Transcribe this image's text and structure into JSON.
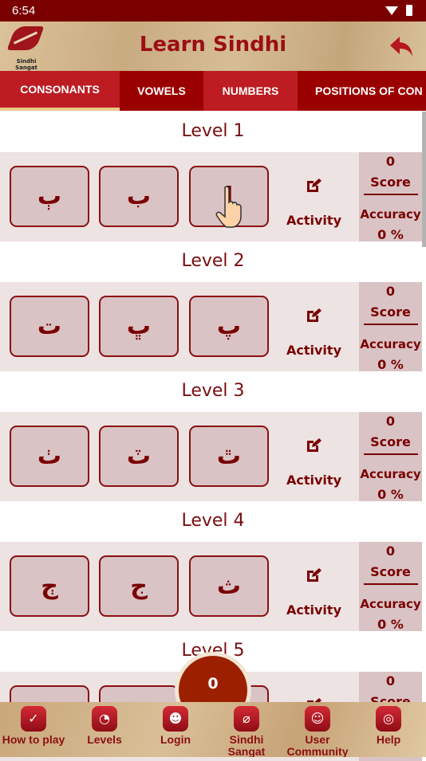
{
  "status_bar": {
    "time": "6:54"
  },
  "header": {
    "logo_text": "Sindhi Sangat",
    "title": "Learn Sindhi"
  },
  "tabs": [
    {
      "label": "CONSONANTS",
      "selected": true
    },
    {
      "label": "VOWELS"
    },
    {
      "label": "NUMBERS"
    },
    {
      "label": "POSITIONS OF CON"
    }
  ],
  "activity_label": "Activity",
  "score_label": "Score",
  "accuracy_label": "Accuracy",
  "levels": [
    {
      "label": "Level 1",
      "letters": [
        "ٻ",
        "ب",
        "ا"
      ],
      "score": "0",
      "accuracy": "0 %"
    },
    {
      "label": "Level 2",
      "letters": [
        "ت",
        "ڀ",
        "پ"
      ],
      "score": "0",
      "accuracy": "0 %"
    },
    {
      "label": "Level 3",
      "letters": [
        "ٺ",
        "ٽ",
        "ٿ"
      ],
      "score": "0",
      "accuracy": "0 %"
    },
    {
      "label": "Level 4",
      "letters": [
        "ڄ",
        "ج",
        "ث"
      ],
      "score": "0",
      "accuracy": "0 %"
    },
    {
      "label": "Level 5",
      "letters": [
        "",
        "",
        ""
      ],
      "score": "0",
      "accuracy": ""
    }
  ],
  "fab_value": "0",
  "bottom_nav": [
    {
      "label": "How to play",
      "icon": "how-to-play-icon"
    },
    {
      "label": "Levels",
      "icon": "gauge-icon"
    },
    {
      "label": "Login",
      "icon": "user-icon"
    },
    {
      "label": "Sindhi Sangat",
      "icon": "sindhi-sangat-icon"
    },
    {
      "label": "User Community",
      "icon": "community-icon"
    },
    {
      "label": "Help",
      "icon": "lifebuoy-icon"
    }
  ],
  "colors": {
    "primary": "#9b0000",
    "accent": "#bd1c22",
    "text": "#7a0000",
    "row_bg": "#ede3e2",
    "box_bg": "#d9c3c5"
  }
}
